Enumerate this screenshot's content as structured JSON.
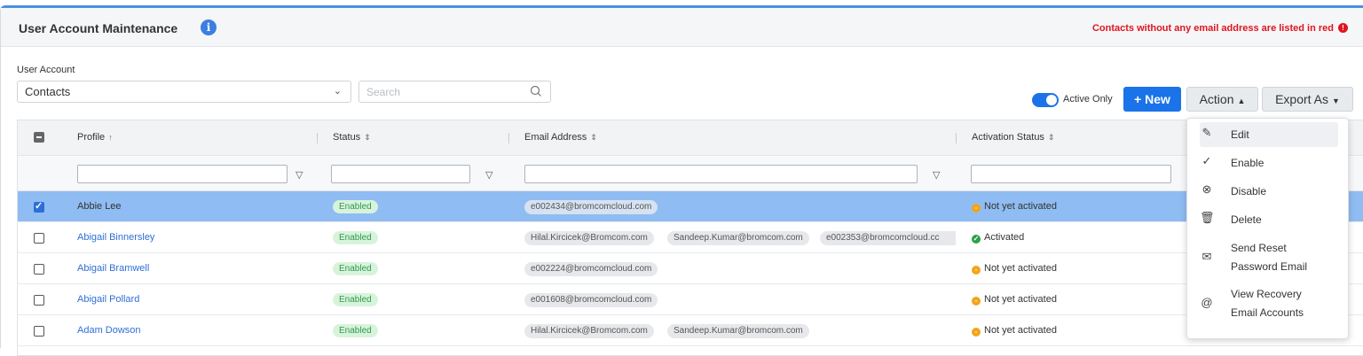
{
  "page": {
    "title": "User Account Maintenance",
    "info_icon": "info-circle-icon",
    "red_note": "Contacts without any email address are listed in red",
    "accent_color": "#1a73e8",
    "warning_color": "#e0141e"
  },
  "filters": {
    "user_account_label": "User Account",
    "user_account_value": "Contacts",
    "search_placeholder": "Search"
  },
  "toolbar": {
    "active_only_label": "Active Only",
    "active_only_on": true,
    "new_label": "+ New",
    "action_label": "Action",
    "export_label": "Export As"
  },
  "grid": {
    "columns": [
      {
        "label": "Profile",
        "sort": "asc"
      },
      {
        "label": "Status",
        "sort": "none"
      },
      {
        "label": "Email Address",
        "sort": "none"
      },
      {
        "label": "Activation Status",
        "sort": "none"
      }
    ],
    "rows": [
      {
        "profile": "Abbie Lee",
        "status": "Enabled",
        "emails": [
          "e002434@bromcomcloud.com"
        ],
        "activation": "Not yet activated",
        "activation_state": "pending",
        "selected": true
      },
      {
        "profile": "Abigail Binnersley",
        "status": "Enabled",
        "emails": [
          "Hilal.Kircicek@Bromcom.com",
          "Sandeep.Kumar@bromcom.com",
          "e002353@bromcomcloud.cc"
        ],
        "activation": "Activated",
        "activation_state": "ok",
        "selected": false
      },
      {
        "profile": "Abigail Bramwell",
        "status": "Enabled",
        "emails": [
          "e002224@bromcomcloud.com"
        ],
        "activation": "Not yet activated",
        "activation_state": "pending",
        "selected": false
      },
      {
        "profile": "Abigail Pollard",
        "status": "Enabled",
        "emails": [
          "e001608@bromcomcloud.com"
        ],
        "activation": "Not yet activated",
        "activation_state": "pending",
        "selected": false
      },
      {
        "profile": "Adam Dowson",
        "status": "Enabled",
        "emails": [
          "Hilal.Kircicek@Bromcom.com",
          "Sandeep.Kumar@bromcom.com"
        ],
        "activation": "Not yet activated",
        "activation_state": "pending",
        "selected": false
      }
    ]
  },
  "action_menu": {
    "items": [
      {
        "label": "Edit",
        "icon": "edit-icon"
      },
      {
        "label": "Enable",
        "icon": "check-circle-icon"
      },
      {
        "label": "Disable",
        "icon": "x-circle-icon"
      },
      {
        "label": "Delete",
        "icon": "trash-icon"
      },
      {
        "label": "Send Reset\nPassword Email",
        "label_line1": "Send Reset",
        "label_line2": "Password Email",
        "icon": "email-reset-icon"
      },
      {
        "label": "View Recovery\nEmail Accounts",
        "label_line1": "View Recovery",
        "label_line2": "Email Accounts",
        "icon": "at-icon"
      }
    ]
  }
}
